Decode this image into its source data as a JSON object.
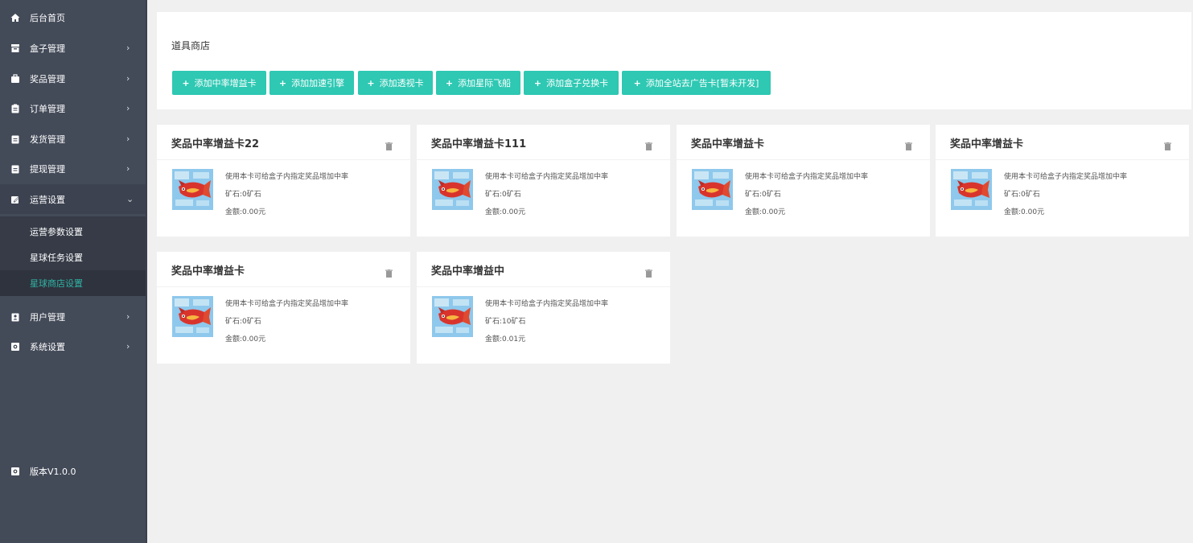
{
  "sidebar": {
    "items": [
      {
        "label": "后台首页",
        "icon": "home-icon",
        "has_arrow": false
      },
      {
        "label": "盒子管理",
        "icon": "box-icon",
        "has_arrow": true,
        "arrow": "›"
      },
      {
        "label": "奖品管理",
        "icon": "bag-icon",
        "has_arrow": true,
        "arrow": "›"
      },
      {
        "label": "订单管理",
        "icon": "clipboard-icon",
        "has_arrow": true,
        "arrow": "›"
      },
      {
        "label": "发货管理",
        "icon": "clipboard-icon",
        "has_arrow": true,
        "arrow": "›"
      },
      {
        "label": "提现管理",
        "icon": "clipboard-icon",
        "has_arrow": true,
        "arrow": "›"
      },
      {
        "label": "运营设置",
        "icon": "edit-icon",
        "has_arrow": true,
        "arrow": "⌄",
        "open": true
      }
    ],
    "sub_items": [
      {
        "label": "运营参数设置",
        "active": false
      },
      {
        "label": "星球任务设置",
        "active": false
      },
      {
        "label": "星球商店设置",
        "active": true
      }
    ],
    "items_after": [
      {
        "label": "用户管理",
        "icon": "user-badge-icon",
        "arrow": "›"
      },
      {
        "label": "系统设置",
        "icon": "settings-icon",
        "arrow": "›"
      }
    ],
    "version": "版本V1.0.0",
    "active_color": "#2fb4a6"
  },
  "header": {
    "title": "道具商店",
    "buttons": [
      {
        "label": "添加中率增益卡"
      },
      {
        "label": "添加加速引擎"
      },
      {
        "label": "添加透视卡"
      },
      {
        "label": "添加星际飞船"
      },
      {
        "label": "添加盒子兑换卡"
      },
      {
        "label": "添加全站去广告卡[暂未开发]"
      }
    ],
    "button_color": "#2ec8b3"
  },
  "cards": [
    {
      "title": "奖品中率增益卡22",
      "desc": "使用本卡可给盒子内指定奖品增加中率",
      "ore": "矿石:0矿石",
      "amount": "金额:0.00元"
    },
    {
      "title": "奖品中率增益卡111",
      "desc": "使用本卡可给盒子内指定奖品增加中率",
      "ore": "矿石:0矿石",
      "amount": "金额:0.00元"
    },
    {
      "title": "奖品中率增益卡",
      "desc": "使用本卡可给盒子内指定奖品增加中率",
      "ore": "矿石:0矿石",
      "amount": "金额:0.00元"
    },
    {
      "title": "奖品中率增益卡",
      "desc": "使用本卡可给盒子内指定奖品增加中率",
      "ore": "矿石:0矿石",
      "amount": "金额:0.00元"
    },
    {
      "title": "奖品中率增益卡",
      "desc": "使用本卡可给盒子内指定奖品增加中率",
      "ore": "矿石:0矿石",
      "amount": "金额:0.00元"
    },
    {
      "title": "奖品中率增益中",
      "desc": "使用本卡可给盒子内指定奖品增加中率",
      "ore": "矿石:10矿石",
      "amount": "金额:0.01元"
    }
  ]
}
